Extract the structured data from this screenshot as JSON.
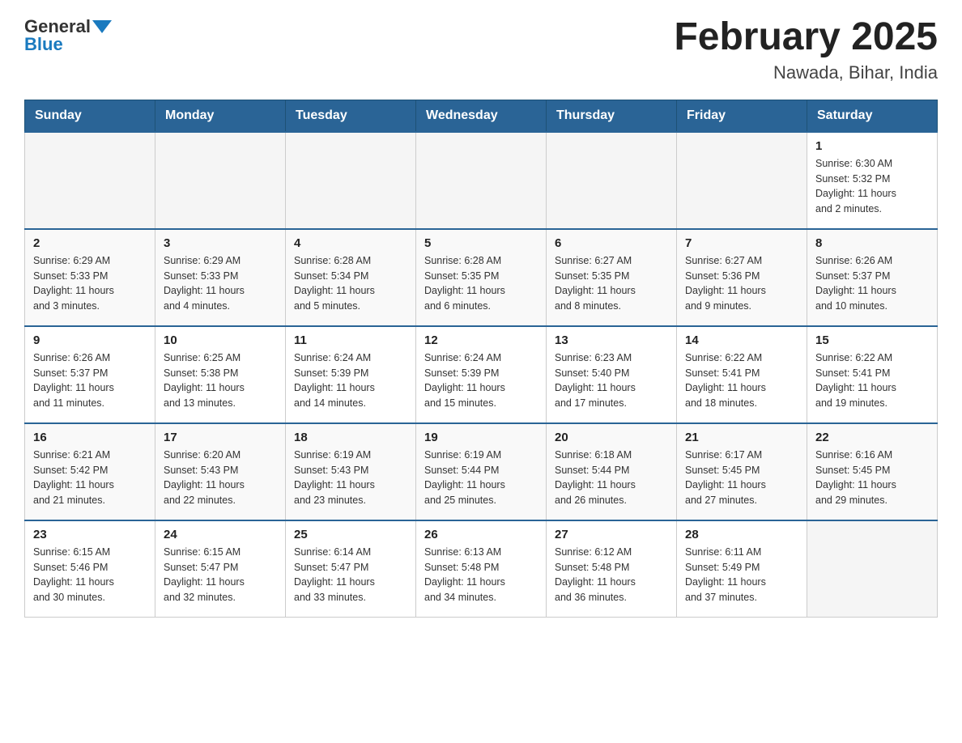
{
  "header": {
    "logo_general": "General",
    "logo_blue": "Blue",
    "title": "February 2025",
    "location": "Nawada, Bihar, India"
  },
  "weekdays": [
    "Sunday",
    "Monday",
    "Tuesday",
    "Wednesday",
    "Thursday",
    "Friday",
    "Saturday"
  ],
  "weeks": [
    [
      {
        "day": "",
        "info": ""
      },
      {
        "day": "",
        "info": ""
      },
      {
        "day": "",
        "info": ""
      },
      {
        "day": "",
        "info": ""
      },
      {
        "day": "",
        "info": ""
      },
      {
        "day": "",
        "info": ""
      },
      {
        "day": "1",
        "info": "Sunrise: 6:30 AM\nSunset: 5:32 PM\nDaylight: 11 hours\nand 2 minutes."
      }
    ],
    [
      {
        "day": "2",
        "info": "Sunrise: 6:29 AM\nSunset: 5:33 PM\nDaylight: 11 hours\nand 3 minutes."
      },
      {
        "day": "3",
        "info": "Sunrise: 6:29 AM\nSunset: 5:33 PM\nDaylight: 11 hours\nand 4 minutes."
      },
      {
        "day": "4",
        "info": "Sunrise: 6:28 AM\nSunset: 5:34 PM\nDaylight: 11 hours\nand 5 minutes."
      },
      {
        "day": "5",
        "info": "Sunrise: 6:28 AM\nSunset: 5:35 PM\nDaylight: 11 hours\nand 6 minutes."
      },
      {
        "day": "6",
        "info": "Sunrise: 6:27 AM\nSunset: 5:35 PM\nDaylight: 11 hours\nand 8 minutes."
      },
      {
        "day": "7",
        "info": "Sunrise: 6:27 AM\nSunset: 5:36 PM\nDaylight: 11 hours\nand 9 minutes."
      },
      {
        "day": "8",
        "info": "Sunrise: 6:26 AM\nSunset: 5:37 PM\nDaylight: 11 hours\nand 10 minutes."
      }
    ],
    [
      {
        "day": "9",
        "info": "Sunrise: 6:26 AM\nSunset: 5:37 PM\nDaylight: 11 hours\nand 11 minutes."
      },
      {
        "day": "10",
        "info": "Sunrise: 6:25 AM\nSunset: 5:38 PM\nDaylight: 11 hours\nand 13 minutes."
      },
      {
        "day": "11",
        "info": "Sunrise: 6:24 AM\nSunset: 5:39 PM\nDaylight: 11 hours\nand 14 minutes."
      },
      {
        "day": "12",
        "info": "Sunrise: 6:24 AM\nSunset: 5:39 PM\nDaylight: 11 hours\nand 15 minutes."
      },
      {
        "day": "13",
        "info": "Sunrise: 6:23 AM\nSunset: 5:40 PM\nDaylight: 11 hours\nand 17 minutes."
      },
      {
        "day": "14",
        "info": "Sunrise: 6:22 AM\nSunset: 5:41 PM\nDaylight: 11 hours\nand 18 minutes."
      },
      {
        "day": "15",
        "info": "Sunrise: 6:22 AM\nSunset: 5:41 PM\nDaylight: 11 hours\nand 19 minutes."
      }
    ],
    [
      {
        "day": "16",
        "info": "Sunrise: 6:21 AM\nSunset: 5:42 PM\nDaylight: 11 hours\nand 21 minutes."
      },
      {
        "day": "17",
        "info": "Sunrise: 6:20 AM\nSunset: 5:43 PM\nDaylight: 11 hours\nand 22 minutes."
      },
      {
        "day": "18",
        "info": "Sunrise: 6:19 AM\nSunset: 5:43 PM\nDaylight: 11 hours\nand 23 minutes."
      },
      {
        "day": "19",
        "info": "Sunrise: 6:19 AM\nSunset: 5:44 PM\nDaylight: 11 hours\nand 25 minutes."
      },
      {
        "day": "20",
        "info": "Sunrise: 6:18 AM\nSunset: 5:44 PM\nDaylight: 11 hours\nand 26 minutes."
      },
      {
        "day": "21",
        "info": "Sunrise: 6:17 AM\nSunset: 5:45 PM\nDaylight: 11 hours\nand 27 minutes."
      },
      {
        "day": "22",
        "info": "Sunrise: 6:16 AM\nSunset: 5:45 PM\nDaylight: 11 hours\nand 29 minutes."
      }
    ],
    [
      {
        "day": "23",
        "info": "Sunrise: 6:15 AM\nSunset: 5:46 PM\nDaylight: 11 hours\nand 30 minutes."
      },
      {
        "day": "24",
        "info": "Sunrise: 6:15 AM\nSunset: 5:47 PM\nDaylight: 11 hours\nand 32 minutes."
      },
      {
        "day": "25",
        "info": "Sunrise: 6:14 AM\nSunset: 5:47 PM\nDaylight: 11 hours\nand 33 minutes."
      },
      {
        "day": "26",
        "info": "Sunrise: 6:13 AM\nSunset: 5:48 PM\nDaylight: 11 hours\nand 34 minutes."
      },
      {
        "day": "27",
        "info": "Sunrise: 6:12 AM\nSunset: 5:48 PM\nDaylight: 11 hours\nand 36 minutes."
      },
      {
        "day": "28",
        "info": "Sunrise: 6:11 AM\nSunset: 5:49 PM\nDaylight: 11 hours\nand 37 minutes."
      },
      {
        "day": "",
        "info": ""
      }
    ]
  ]
}
